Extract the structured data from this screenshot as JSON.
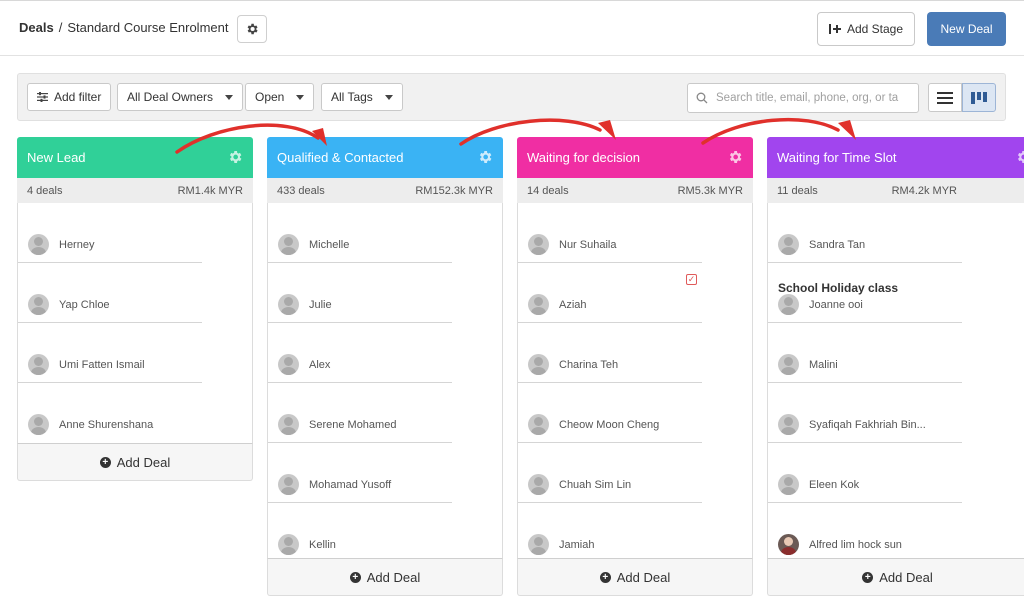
{
  "header": {
    "breadcrumb_root": "Deals",
    "breadcrumb_sep": "/",
    "pipeline_name": "Standard Course Enrolment",
    "add_stage_label": "Add Stage",
    "new_deal_label": "New Deal"
  },
  "filters": {
    "add_filter_label": "Add filter",
    "owners_label": "All Deal Owners",
    "status_label": "Open",
    "tags_label": "All Tags",
    "search_placeholder": "Search title, email, phone, org, or ta"
  },
  "colors": {
    "new_lead": "#30d098",
    "qualified": "#3ab3f4",
    "waiting_decision": "#f02ea3",
    "waiting_slot": "#a145ee",
    "arrow": "#e0302b",
    "primary_button": "#4a7bb7"
  },
  "columns": [
    {
      "title": "New Lead",
      "count": "4 deals",
      "amount": "RM1.4k MYR",
      "deals": [
        {
          "name": "Herney"
        },
        {
          "name": "Yap Chloe"
        },
        {
          "name": "Umi Fatten Ismail"
        },
        {
          "name": "Anne Shurenshana"
        }
      ],
      "add_label": "Add Deal"
    },
    {
      "title": "Qualified & Contacted",
      "count": "433 deals",
      "amount": "RM152.3k MYR",
      "deals": [
        {
          "name": "Michelle"
        },
        {
          "name": "Julie"
        },
        {
          "name": "Alex"
        },
        {
          "name": "Serene Mohamed"
        },
        {
          "name": "Mohamad Yusoff"
        },
        {
          "name": "Kellin"
        }
      ],
      "add_label": "Add Deal"
    },
    {
      "title": "Waiting for decision",
      "count": "14 deals",
      "amount": "RM5.3k MYR",
      "deals": [
        {
          "name": "Nur Suhaila"
        },
        {
          "name": "Aziah"
        },
        {
          "name": "Charina Teh"
        },
        {
          "name": "Cheow Moon Cheng"
        },
        {
          "name": "Chuah Sim Lin"
        },
        {
          "name": "Jamiah"
        }
      ],
      "add_label": "Add Deal"
    },
    {
      "title": "Waiting for Time Slot",
      "count": "11 deals",
      "amount": "RM4.2k MYR",
      "deals": [
        {
          "name": "Sandra Tan"
        },
        {
          "title": "School Holiday class",
          "name": "Joanne ooi"
        },
        {
          "name": "Malini"
        },
        {
          "name": "Syafiqah Fakhriah Bin..."
        },
        {
          "name": "Eleen Kok"
        },
        {
          "name": "Alfred lim hock sun"
        }
      ],
      "add_label": "Add Deal"
    }
  ]
}
